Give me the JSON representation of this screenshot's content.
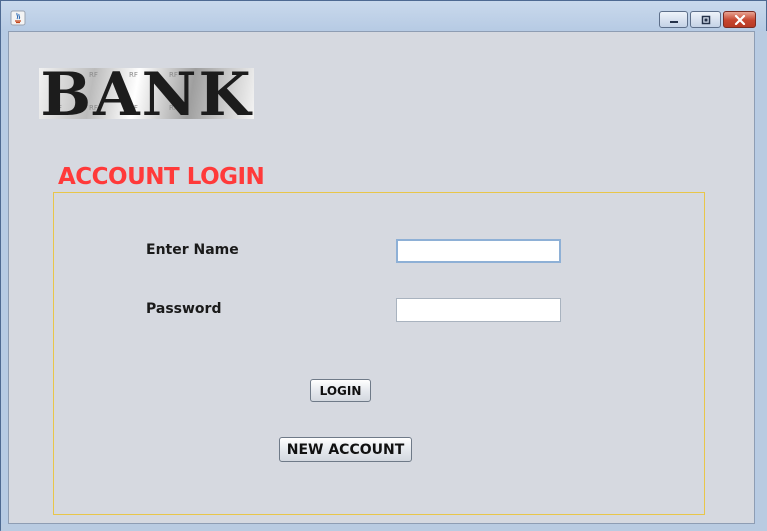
{
  "window": {
    "title": "",
    "minimize_icon": "minimize-icon",
    "maximize_icon": "restore-icon",
    "close_icon": "close-icon"
  },
  "logo": {
    "text": "BANK",
    "watermark": "RF"
  },
  "form": {
    "heading": "ACCOUNT LOGIN",
    "name_label": "Enter Name",
    "name_value": "",
    "password_label": "Password",
    "password_value": "",
    "login_button": "LOGIN",
    "new_account_button": "NEW ACCOUNT"
  },
  "colors": {
    "heading": "#ff3a3a",
    "panel_border": "#e8c64a",
    "client_background": "#d6d9e0"
  }
}
